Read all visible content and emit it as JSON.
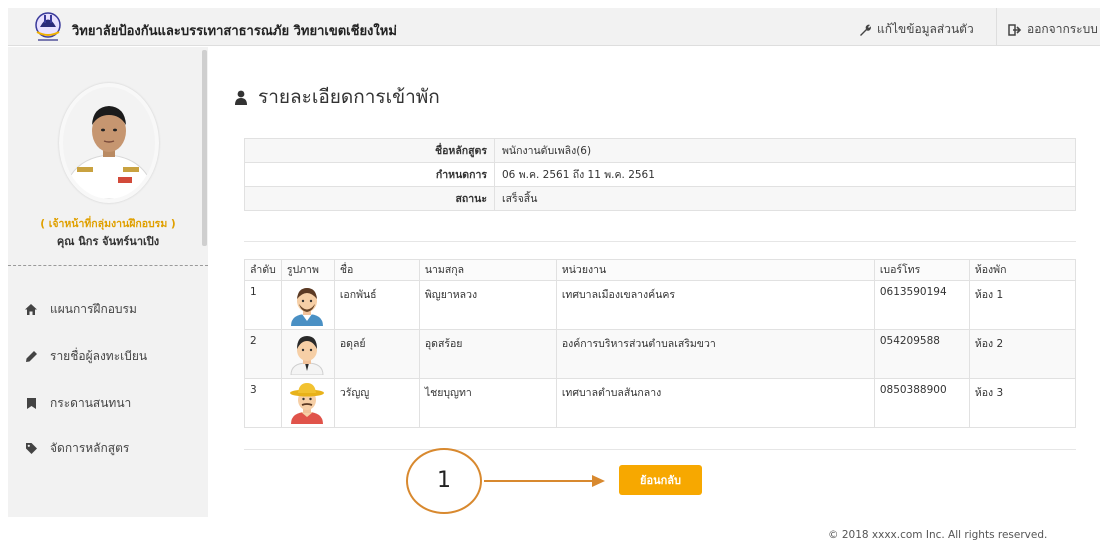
{
  "header": {
    "site_title": "วิทยาลัยป้องกันและบรรเทาสาธารณภัย วิทยาเขตเชียงใหม่",
    "edit_profile": "แก้ไขข้อมูลส่วนตัว",
    "logout": "ออกจากระบบ"
  },
  "sidebar": {
    "role": "( เจ้าหน้าที่กลุ่มงานฝึกอบรม )",
    "username": "คุณ นิกร จันทร์นาเปิง",
    "menu": [
      {
        "label": "แผนการฝึกอบรม",
        "icon": "home-icon"
      },
      {
        "label": "รายชื่อผู้ลงทะเบียน",
        "icon": "pencil-icon"
      },
      {
        "label": "กระดานสนทนา",
        "icon": "bookmark-icon"
      },
      {
        "label": "จัดการหลักสูตร",
        "icon": "tag-icon"
      }
    ]
  },
  "main": {
    "title": "รายละเอียดการเข้าพัก",
    "info": {
      "course_label": "ชื่อหลักสูตร",
      "course_value": "พนักงานดับเพลิง(6)",
      "schedule_label": "กำหนดการ",
      "schedule_value": "06 พ.ค. 2561 ถึง 11 พ.ค. 2561",
      "status_label": "สถานะ",
      "status_value": "เสร็จสิ้น"
    },
    "columns": [
      "ลำดับ",
      "รูปภาพ",
      "ชื่อ",
      "นามสกุล",
      "หน่วยงาน",
      "เบอร์โทร",
      "ห้องพัก"
    ],
    "rows": [
      {
        "no": "1",
        "first": "เอกพันธ์",
        "last": "พิญยาหลวง",
        "org": "เทศบาลเมืองเขลางค์นคร",
        "phone": "0613590194",
        "room": "ห้อง 1"
      },
      {
        "no": "2",
        "first": "อดุลย์",
        "last": "อุดสร้อย",
        "org": "องค์การบริหารส่วนตำบลเสริมขวา",
        "phone": "054209588",
        "room": "ห้อง 2"
      },
      {
        "no": "3",
        "first": "วรัญญู",
        "last": "ไชยบุญทา",
        "org": "เทศบาลตำบลสันกลาง",
        "phone": "0850388900",
        "room": "ห้อง 3"
      }
    ],
    "back_button": "ย้อนกลับ"
  },
  "annotation": {
    "number": "1",
    "color": "#d8892f"
  },
  "colors": {
    "accent": "#f7a800",
    "role_text": "#e0a000"
  },
  "footer": "© 2018 xxxx.com Inc. All rights reserved."
}
